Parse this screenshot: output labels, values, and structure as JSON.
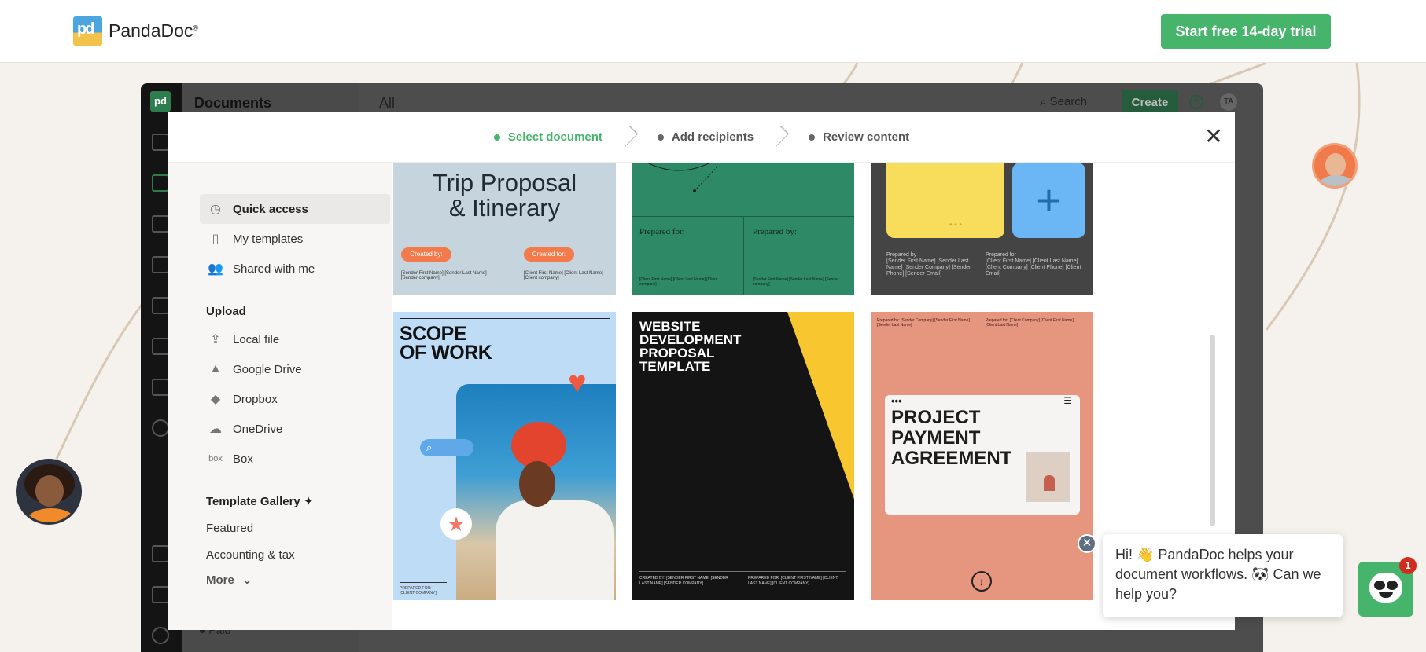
{
  "brand": {
    "name": "PandaDoc",
    "mark": "pd",
    "trial_button": "Start free 14-day trial",
    "accent": "#47b46c"
  },
  "app": {
    "sidebar_title": "Documents",
    "main_title": "All",
    "search_label": "Search",
    "create_label": "Create",
    "help_label": "?",
    "user_initials": "TA",
    "paid_label": "Paid"
  },
  "modal": {
    "steps": [
      {
        "label": "Select document",
        "active": true
      },
      {
        "label": "Add recipients",
        "active": false
      },
      {
        "label": "Review content",
        "active": false
      }
    ],
    "close_label": "✕",
    "nav": {
      "quick_access": "Quick access",
      "my_templates": "My templates",
      "shared_with_me": "Shared with me",
      "upload_heading": "Upload",
      "upload": [
        "Local file",
        "Google Drive",
        "Dropbox",
        "OneDrive",
        "Box"
      ],
      "gallery_heading": "Template Gallery",
      "gallery": [
        "Featured",
        "Accounting & tax"
      ],
      "more": "More"
    },
    "cards": {
      "trip": {
        "title_top": "Trip Proposal",
        "title_bottom": "& Itinerary",
        "created_by": "Created by:",
        "created_for": "Created for:",
        "sender": "[Sender First Name] [Sender Last Name] [Sender company]",
        "client": "[Client First Name] [Client Last Name] [Client company]"
      },
      "green": {
        "prepared_for": "Prepared for:",
        "prepared_by": "Prepared by:",
        "client": "[Client First Name] [Client Last Name] [Client company]",
        "sender": "[Sender First Name] [Sender Last Name] [Sender company]"
      },
      "dark": {
        "plus": "+",
        "prepared_by": "Prepared by",
        "prepared_for": "Prepared for",
        "sender_lines": "[Sender First Name] [Sender Last Name] [Sender Company] [Sender Phone] [Sender Email]",
        "client_lines": "[Client First Name] [Client Last Name] [Client Company] [Client Phone] [Client Email]"
      },
      "scope": {
        "title_line1": "SCOPE",
        "title_line2": "OF WORK",
        "meta": "PREPARED FOR: [CLIENT COMPANY]"
      },
      "website": {
        "title": "WEBSITE DEVELOPMENT PROPOSAL TEMPLATE",
        "created_by": "CREATED BY: [SENDER FIRST NAME] [SENDER LAST NAME] [SENDER COMPANY]",
        "prepared_for": "PREPARED FOR: [CLIENT FIRST NAME] [CLIENT LAST NAME] [CLIENT COMPANY]"
      },
      "payment": {
        "title": "PROJECT PAYMENT AGREEMENT",
        "prepared_by": "Prepared by: [Sender Company] [Sender First Name] [Sender Last Name]",
        "prepared_for": "Prepared for: [Client Company] [Client First Name] [Client Last Name]"
      }
    }
  },
  "chat": {
    "message": "Hi! 👋 PandaDoc helps your document workflows. 🐼 Can we help you?",
    "badge_count": "1",
    "close_label": "✕"
  }
}
